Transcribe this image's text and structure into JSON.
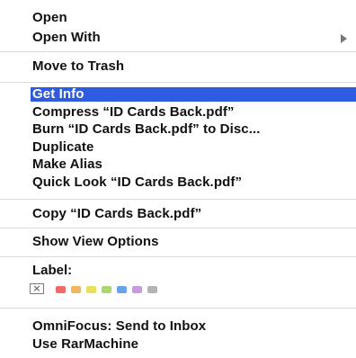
{
  "menu": {
    "open": "Open",
    "open_with": "Open With",
    "move_to_trash": "Move to Trash",
    "get_info": "Get Info",
    "compress": "Compress “ID Cards Back.pdf”",
    "burn": "Burn “ID Cards Back.pdf” to Disc...",
    "duplicate": "Duplicate",
    "make_alias": "Make Alias",
    "quick_look": "Quick Look “ID Cards Back.pdf”",
    "copy": "Copy “ID Cards Back.pdf”",
    "show_view_options": "Show View Options",
    "label_title": "Label:",
    "omnifocus": "OmniFocus: Send to Inbox",
    "rarmachine": "Use RarMachine"
  },
  "labels": {
    "none_glyph": "×",
    "colors": [
      {
        "name": "red",
        "hex": "#f06a6a"
      },
      {
        "name": "orange",
        "hex": "#f4b45c"
      },
      {
        "name": "yellow",
        "hex": "#eadf5c"
      },
      {
        "name": "green",
        "hex": "#a8d96a"
      },
      {
        "name": "blue",
        "hex": "#6aa3ea"
      },
      {
        "name": "purple",
        "hex": "#c89ae0"
      },
      {
        "name": "gray",
        "hex": "#b4b4b4"
      }
    ]
  },
  "colors": {
    "highlight": "#2f5be0",
    "separator": "#dcdcdc"
  }
}
